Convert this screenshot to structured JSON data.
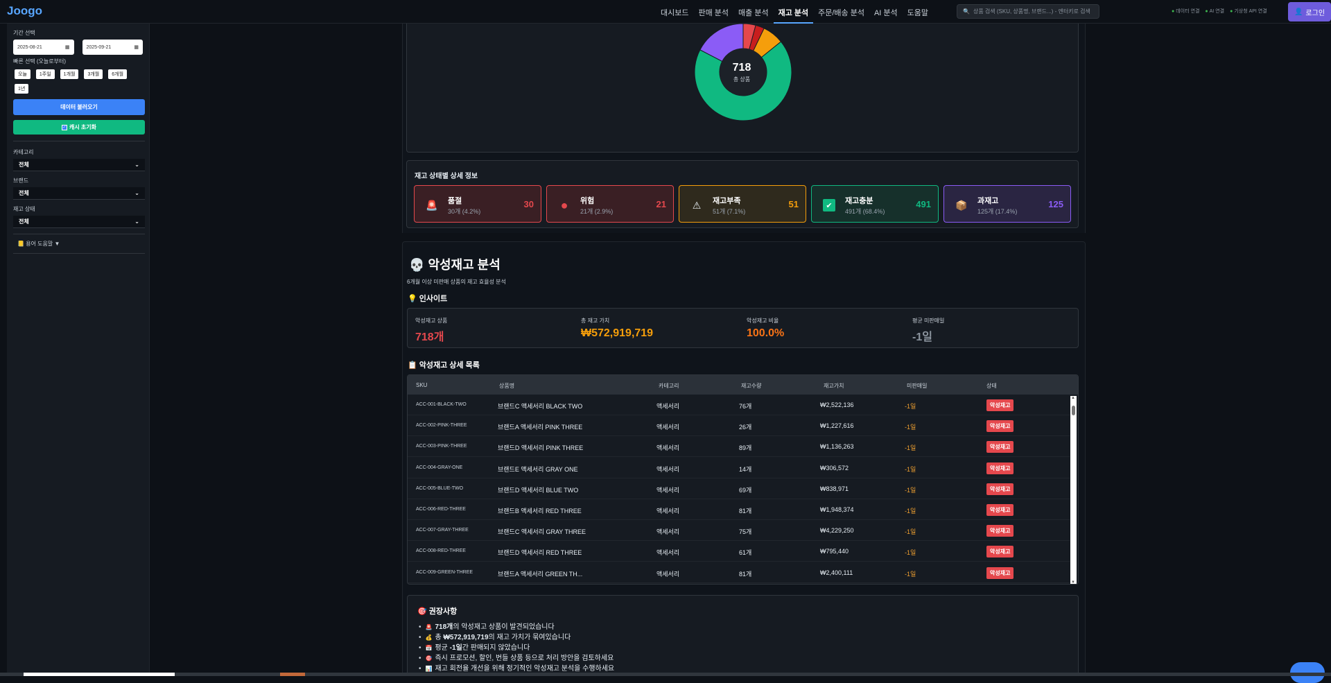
{
  "header": {
    "logo": "Joogo",
    "nav": [
      {
        "label": "대시보드",
        "active": false
      },
      {
        "label": "판매 분석",
        "active": false
      },
      {
        "label": "매출 분석",
        "active": false
      },
      {
        "label": "재고 분석",
        "active": true
      },
      {
        "label": "주문/배송 분석",
        "active": false
      },
      {
        "label": "AI 분석",
        "active": false
      },
      {
        "label": "도움말",
        "active": false
      }
    ],
    "search_placeholder": "상품 검색 (SKU, 상품명, 브랜드...) - 엔터키로 검색",
    "status": [
      "데이터 연결",
      "AI 연결",
      "기상청 API 연결"
    ],
    "login_label": "로그인"
  },
  "sidebar": {
    "period_label": "기간 선택",
    "start_date": "2025-08-21",
    "end_date": "2025-09-21",
    "quick_label": "빠른 선택 (오늘로부터)",
    "quick_buttons": [
      "오늘",
      "1주일",
      "1개월",
      "3개월",
      "6개월",
      "1년"
    ],
    "load_button": "데이터 불러오기",
    "cache_button": "캐시 초기화",
    "category_label": "카테고리",
    "category_value": "전체",
    "brand_label": "브랜드",
    "brand_value": "전체",
    "stock_status_label": "재고 상태",
    "stock_status_value": "전체",
    "help_label": "용어 도움말"
  },
  "donut": {
    "total": "718",
    "total_label": "총 상품",
    "colors": {
      "stockout": "#e5484d",
      "danger": "#c81e1e",
      "low": "#f59e0b",
      "ok": "#10b981",
      "over": "#8b5cf6"
    }
  },
  "status_detail": {
    "title": "재고 상태별 상세 정보",
    "cards": [
      {
        "icon": "siren-icon",
        "glyph": "🚨",
        "name": "품절",
        "sub": "30개 (4.2%)",
        "value": "30",
        "color": "#e5484d",
        "bg": "#3a1f24",
        "border": "#e5484d"
      },
      {
        "icon": "red-circle-icon",
        "glyph": "●",
        "name": "위험",
        "sub": "21개 (2.9%)",
        "value": "21",
        "color": "#e5484d",
        "bg": "#3a1f24",
        "border": "#e5484d"
      },
      {
        "icon": "warning-icon",
        "glyph": "⚠",
        "name": "재고부족",
        "sub": "51개 (7.1%)",
        "value": "51",
        "color": "#f59e0b",
        "bg": "#2f2a1d",
        "border": "#f59e0b"
      },
      {
        "icon": "check-icon",
        "glyph": "✔",
        "name": "재고충분",
        "sub": "491개 (68.4%)",
        "value": "491",
        "color": "#10b981",
        "bg": "#16302b",
        "border": "#10b981"
      },
      {
        "icon": "box-icon",
        "glyph": "📦",
        "name": "과재고",
        "sub": "125개 (17.4%)",
        "value": "125",
        "color": "#8b5cf6",
        "bg": "#2a2542",
        "border": "#8b5cf6"
      }
    ]
  },
  "dead_stock": {
    "title": "악성재고 분석",
    "subtitle": "6개월 이상 미판매 상품의 재고 효율성 분석",
    "insight_title": "인사이트",
    "insights": [
      {
        "label": "악성재고 상품",
        "value": "718개",
        "color": "#e5484d"
      },
      {
        "label": "총 재고 가치",
        "value": "₩572,919,719",
        "color": "#f59e0b"
      },
      {
        "label": "악성재고 비율",
        "value": "100.0%",
        "color": "#f97316"
      },
      {
        "label": "평균 미판매일",
        "value": "-1일",
        "color": "#8b949e"
      }
    ],
    "list_title": "악성재고 상세 목록",
    "columns": [
      "SKU",
      "상품명",
      "카테고리",
      "재고수량",
      "재고가치",
      "미판매일",
      "상태"
    ],
    "rows": [
      {
        "sku": "ACC-001-BLACK-TWO",
        "name": "브랜드C 액세서리 BLACK TWO",
        "category": "액세서리",
        "qty": "76개",
        "value": "₩2,522,136",
        "days": "-1일",
        "status": "악성재고"
      },
      {
        "sku": "ACC-002-PINK-THREE",
        "name": "브랜드A 액세서리 PINK THREE",
        "category": "액세서리",
        "qty": "26개",
        "value": "₩1,227,616",
        "days": "-1일",
        "status": "악성재고"
      },
      {
        "sku": "ACC-003-PINK-THREE",
        "name": "브랜드D 액세서리 PINK THREE",
        "category": "액세서리",
        "qty": "89개",
        "value": "₩1,136,263",
        "days": "-1일",
        "status": "악성재고"
      },
      {
        "sku": "ACC-004-GRAY-ONE",
        "name": "브랜드E 액세서리 GRAY ONE",
        "category": "액세서리",
        "qty": "14개",
        "value": "₩306,572",
        "days": "-1일",
        "status": "악성재고"
      },
      {
        "sku": "ACC-005-BLUE-TWO",
        "name": "브랜드D 액세서리 BLUE TWO",
        "category": "액세서리",
        "qty": "69개",
        "value": "₩838,971",
        "days": "-1일",
        "status": "악성재고"
      },
      {
        "sku": "ACC-006-RED-THREE",
        "name": "브랜드B 액세서리 RED THREE",
        "category": "액세서리",
        "qty": "81개",
        "value": "₩1,948,374",
        "days": "-1일",
        "status": "악성재고"
      },
      {
        "sku": "ACC-007-GRAY-THREE",
        "name": "브랜드C 액세서리 GRAY THREE",
        "category": "액세서리",
        "qty": "75개",
        "value": "₩4,229,250",
        "days": "-1일",
        "status": "악성재고"
      },
      {
        "sku": "ACC-008-RED-THREE",
        "name": "브랜드D 액세서리 RED THREE",
        "category": "액세서리",
        "qty": "61개",
        "value": "₩795,440",
        "days": "-1일",
        "status": "악성재고"
      },
      {
        "sku": "ACC-009-GREEN-THREE",
        "name": "브랜드A 액세서리 GREEN TH...",
        "category": "액세서리",
        "qty": "81개",
        "value": "₩2,400,111",
        "days": "-1일",
        "status": "악성재고"
      }
    ]
  },
  "recommendations": {
    "title": "권장사항",
    "items": [
      {
        "glyph": "🚨",
        "bold": "718개",
        "text": "의 악성재고 상품이 발견되었습니다"
      },
      {
        "glyph": "💰",
        "pre": "총 ",
        "bold": "₩572,919,719",
        "text": "의 재고 가치가 묶여있습니다"
      },
      {
        "glyph": "📅",
        "pre": "평균 ",
        "bold": "-1일",
        "text": "간 판매되지 않았습니다"
      },
      {
        "glyph": "🎯",
        "text": "즉시 프로모션, 할인, 번들 상품 등으로 처리 방안을 검토하세요"
      },
      {
        "glyph": "📊",
        "text": "재고 회전율 개선을 위해 정기적인 악성재고 분석을 수행하세요"
      }
    ]
  }
}
